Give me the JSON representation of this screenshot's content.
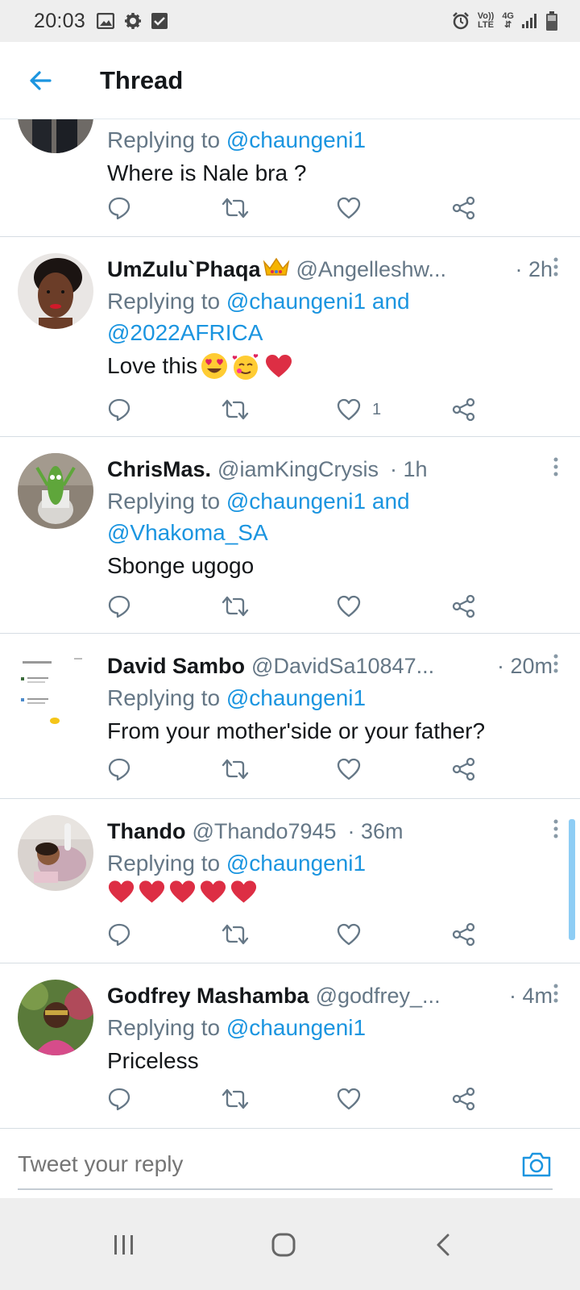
{
  "status_bar": {
    "time": "20:03",
    "left_icons": [
      "image-icon",
      "gear-icon",
      "check-box-icon"
    ],
    "volte_line1": "Vo))",
    "volte_line2": "LTE",
    "network": "4G",
    "right_icons": [
      "alarm-icon",
      "signal-icon",
      "battery-icon"
    ]
  },
  "header": {
    "title": "Thread",
    "back_icon": "arrow-left-icon"
  },
  "colors": {
    "accent": "#1b95e0",
    "text": "#14171a",
    "muted": "#657786",
    "heart": "#e0245e"
  },
  "tweets": [
    {
      "display_name": "",
      "handle": "",
      "time": "",
      "replying_prefix": "Replying to",
      "replying_to": "@chaungeni1",
      "replying_to_2": "",
      "text": "Where is Nale bra ?",
      "like_count": ""
    },
    {
      "display_name": "UmZulu`Phaqa",
      "handle": "@Angelleshw...",
      "time": "· 2h",
      "replying_prefix": "Replying to",
      "replying_to": "@chaungeni1 and",
      "replying_to_2": "@2022AFRICA",
      "text": "Love this",
      "like_count": "1"
    },
    {
      "display_name": "ChrisMas.",
      "handle": "@iamKingCrysis",
      "time": "· 1h",
      "replying_prefix": "Replying to",
      "replying_to": "@chaungeni1 and",
      "replying_to_2": "@Vhakoma_SA",
      "text": "Sbonge ugogo",
      "like_count": ""
    },
    {
      "display_name": "David Sambo",
      "handle": "@DavidSa10847...",
      "time": "· 20m",
      "replying_prefix": "Replying to",
      "replying_to": "@chaungeni1",
      "replying_to_2": "",
      "text": "From your mother'side or your father?",
      "like_count": ""
    },
    {
      "display_name": "Thando",
      "handle": "@Thando7945",
      "time": "· 36m",
      "replying_prefix": "Replying to",
      "replying_to": "@chaungeni1",
      "replying_to_2": "",
      "text": "",
      "like_count": ""
    },
    {
      "display_name": "Godfrey Mashamba",
      "handle": "@godfrey_...",
      "time": "· 4m",
      "replying_prefix": "Replying to",
      "replying_to": "@chaungeni1",
      "replying_to_2": "",
      "text": "Priceless",
      "like_count": ""
    }
  ],
  "action_icons": [
    "reply-icon",
    "retweet-icon",
    "like-icon",
    "share-icon"
  ],
  "composer": {
    "placeholder": "Tweet your reply",
    "camera_icon": "camera-icon"
  },
  "nav_bar": {
    "icons": [
      "recents-icon",
      "home-icon",
      "back-icon"
    ]
  }
}
